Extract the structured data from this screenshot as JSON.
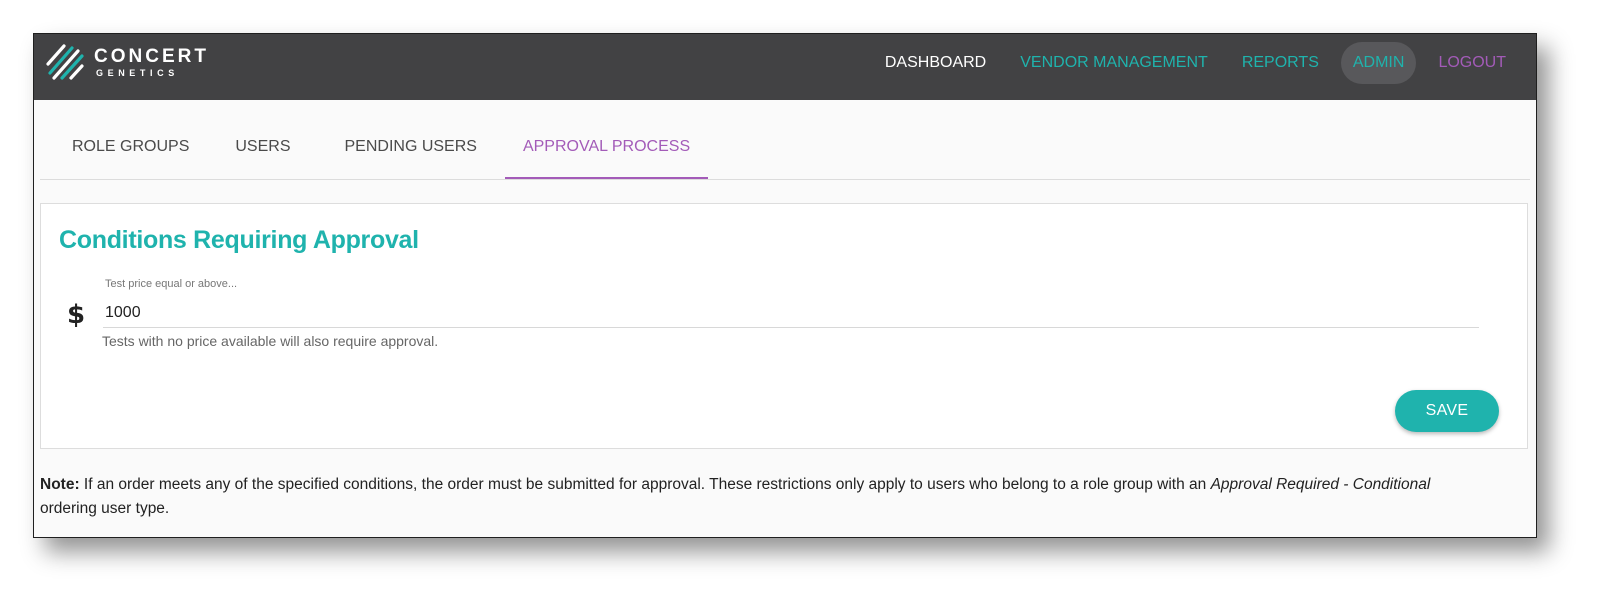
{
  "brand": {
    "name": "CONCERT",
    "tagline": "GENETICS",
    "teal": "#1fb3ad",
    "purple": "#a35bb8",
    "header_bg": "#424244"
  },
  "nav": {
    "items": [
      {
        "label": "DASHBOARD"
      },
      {
        "label": "VENDOR MANAGEMENT"
      },
      {
        "label": "REPORTS"
      },
      {
        "label": "ADMIN",
        "active": true
      },
      {
        "label": "LOGOUT"
      }
    ]
  },
  "tabs": [
    {
      "label": "ROLE GROUPS"
    },
    {
      "label": "USERS"
    },
    {
      "label": "PENDING USERS"
    },
    {
      "label": "APPROVAL PROCESS",
      "active": true
    }
  ],
  "card": {
    "title": "Conditions Requiring Approval",
    "price_field": {
      "label": "Test price equal or above...",
      "currency_symbol": "$",
      "value": "1000",
      "helper": "Tests with no price available will also require approval."
    },
    "save_label": "SAVE"
  },
  "note": {
    "label": "Note:",
    "text_1": " If an order meets any of the specified conditions, the order must be submitted for approval. These restrictions only apply to users who belong to a role group with an ",
    "emphasis": "Approval Required - Conditional",
    "text_2": " ordering user type."
  }
}
